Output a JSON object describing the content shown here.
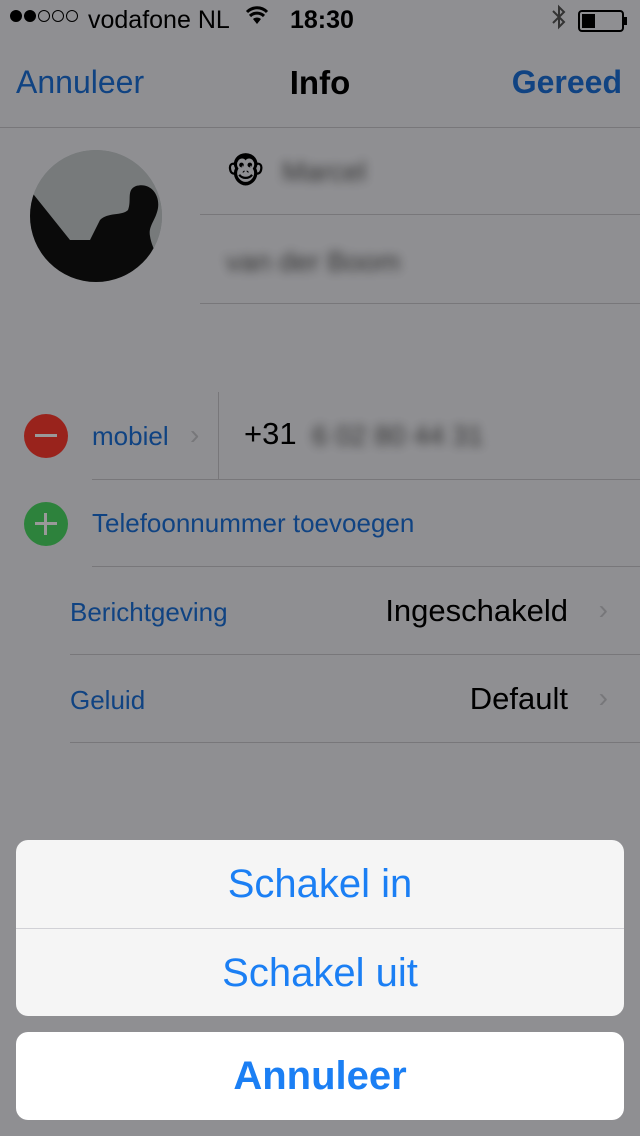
{
  "status_bar": {
    "carrier": "vodafone NL",
    "time": "18:30",
    "signal_bars_filled": 2,
    "signal_bars_total": 5,
    "battery_level": 0.3
  },
  "nav": {
    "cancel_label": "Annuleer",
    "title": "Info",
    "done_label": "Gereed"
  },
  "contact": {
    "first_name_emoji": "🐵",
    "first_name": "Marcel",
    "last_name": "van der Boom"
  },
  "phone": {
    "type_label": "mobiel",
    "prefix": "+31",
    "number": "6 02 80 44 31",
    "add_label": "Telefoonnummer toevoegen"
  },
  "settings": [
    {
      "label": "Berichtgeving",
      "value": "Ingeschakeld"
    },
    {
      "label": "Geluid",
      "value": "Default"
    }
  ],
  "action_sheet": {
    "options": [
      "Schakel in",
      "Schakel uit"
    ],
    "cancel_label": "Annuleer"
  },
  "colors": {
    "accent": "#1b7ff4",
    "remove": "#ff3b30",
    "add": "#4cd964"
  }
}
